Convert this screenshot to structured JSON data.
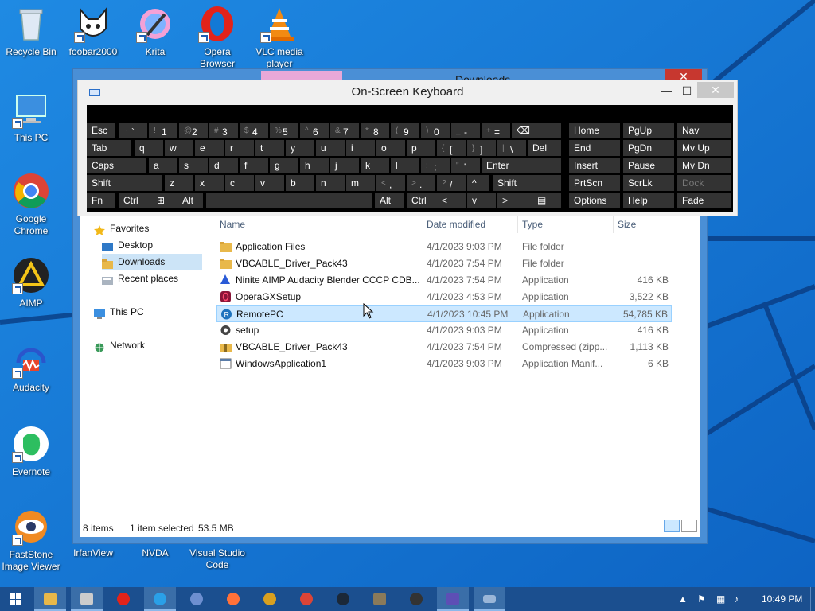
{
  "desktop": {
    "icons": [
      {
        "label": "Recycle Bin"
      },
      {
        "label": "foobar2000"
      },
      {
        "label": "Krita"
      },
      {
        "label": "Opera Browser"
      },
      {
        "label": "VLC media player"
      },
      {
        "label": "This PC"
      },
      {
        "label": "Google Chrome"
      },
      {
        "label": "AIMP"
      },
      {
        "label": "Audacity"
      },
      {
        "label": "Evernote"
      },
      {
        "label": "FastStone Image Viewer"
      },
      {
        "label": "IrfanView"
      },
      {
        "label": "NVDA"
      },
      {
        "label": "Visual Studio Code"
      }
    ]
  },
  "explorer": {
    "title": "Downloads",
    "close_glyph": "✕",
    "nav": {
      "favorites": "Favorites",
      "desktop": "Desktop",
      "downloads": "Downloads",
      "recent": "Recent places",
      "this_pc": "This PC",
      "network": "Network"
    },
    "columns": {
      "name": "Name",
      "date": "Date modified",
      "type": "Type",
      "size": "Size"
    },
    "files": [
      {
        "name": "Application Files",
        "date": "4/1/2023 9:03 PM",
        "type": "File folder",
        "size": ""
      },
      {
        "name": "VBCABLE_Driver_Pack43",
        "date": "4/1/2023 7:54 PM",
        "type": "File folder",
        "size": ""
      },
      {
        "name": "Ninite AIMP Audacity Blender CCCP CDB...",
        "date": "4/1/2023 7:54 PM",
        "type": "Application",
        "size": "416 KB"
      },
      {
        "name": "OperaGXSetup",
        "date": "4/1/2023 4:53 PM",
        "type": "Application",
        "size": "3,522 KB"
      },
      {
        "name": "RemotePC",
        "date": "4/1/2023 10:45 PM",
        "type": "Application",
        "size": "54,785 KB"
      },
      {
        "name": "setup",
        "date": "4/1/2023 9:03 PM",
        "type": "Application",
        "size": "416 KB"
      },
      {
        "name": "VBCABLE_Driver_Pack43",
        "date": "4/1/2023 7:54 PM",
        "type": "Compressed (zipp...",
        "size": "1,113 KB"
      },
      {
        "name": "WindowsApplication1",
        "date": "4/1/2023 9:03 PM",
        "type": "Application Manif...",
        "size": "6 KB"
      }
    ],
    "status": {
      "count": "8 items",
      "selected": "1 item selected",
      "size": "53.5 MB"
    }
  },
  "osk": {
    "title": "On-Screen Keyboard",
    "minimize": "—",
    "maximize": "☐",
    "close": "✕",
    "rows": {
      "r1": [
        {
          "main": "Esc"
        },
        {
          "shift": "~",
          "main": "`"
        },
        {
          "shift": "!",
          "main": "1"
        },
        {
          "shift": "@",
          "main": "2"
        },
        {
          "shift": "#",
          "main": "3"
        },
        {
          "shift": "$",
          "main": "4"
        },
        {
          "shift": "%",
          "main": "5"
        },
        {
          "shift": "^",
          "main": "6"
        },
        {
          "shift": "&",
          "main": "7"
        },
        {
          "shift": "*",
          "main": "8"
        },
        {
          "shift": "(",
          "main": "9"
        },
        {
          "shift": ")",
          "main": "0"
        },
        {
          "shift": "_",
          "main": "-"
        },
        {
          "shift": "+",
          "main": "="
        },
        {
          "main": "⌫"
        },
        {
          "main": "Home"
        },
        {
          "main": "PgUp"
        },
        {
          "main": "Nav"
        }
      ],
      "r2": [
        {
          "main": "Tab"
        },
        {
          "main": "q"
        },
        {
          "main": "w"
        },
        {
          "main": "e"
        },
        {
          "main": "r"
        },
        {
          "main": "t"
        },
        {
          "main": "y"
        },
        {
          "main": "u"
        },
        {
          "main": "i"
        },
        {
          "main": "o"
        },
        {
          "main": "p"
        },
        {
          "shift": "{",
          "main": "["
        },
        {
          "shift": "}",
          "main": "]"
        },
        {
          "shift": "|",
          "main": "\\"
        },
        {
          "main": "Del"
        },
        {
          "main": "End"
        },
        {
          "main": "PgDn"
        },
        {
          "main": "Mv Up"
        }
      ],
      "r3": [
        {
          "main": "Caps"
        },
        {
          "main": "a"
        },
        {
          "main": "s"
        },
        {
          "main": "d"
        },
        {
          "main": "f"
        },
        {
          "main": "g"
        },
        {
          "main": "h"
        },
        {
          "main": "j"
        },
        {
          "main": "k"
        },
        {
          "main": "l"
        },
        {
          "shift": ":",
          "main": ";"
        },
        {
          "shift": "\"",
          "main": "'"
        },
        {
          "main": "Enter"
        },
        {
          "main": "Insert"
        },
        {
          "main": "Pause"
        },
        {
          "main": "Mv Dn"
        }
      ],
      "r4": [
        {
          "main": "Shift"
        },
        {
          "main": "z"
        },
        {
          "main": "x"
        },
        {
          "main": "c"
        },
        {
          "main": "v"
        },
        {
          "main": "b"
        },
        {
          "main": "n"
        },
        {
          "main": "m"
        },
        {
          "shift": "<",
          "main": ","
        },
        {
          "shift": ">",
          "main": "."
        },
        {
          "shift": "?",
          "main": "/"
        },
        {
          "main": "^"
        },
        {
          "main": "Shift"
        },
        {
          "main": "PrtScn"
        },
        {
          "main": "ScrLk"
        },
        {
          "main": "Dock"
        }
      ],
      "r5": [
        {
          "main": "Fn"
        },
        {
          "main": "Ctrl"
        },
        {
          "main": "⊞"
        },
        {
          "main": "Alt"
        },
        {
          "main": ""
        },
        {
          "main": "Alt"
        },
        {
          "main": "Ctrl"
        },
        {
          "main": "<"
        },
        {
          "main": "v"
        },
        {
          "main": ">"
        },
        {
          "main": "▤"
        },
        {
          "main": "Options"
        },
        {
          "main": "Help"
        },
        {
          "main": "Fade"
        }
      ]
    }
  },
  "taskbar": {
    "clock": "10:49 PM"
  },
  "colors": {
    "desktop_bg": "#1279d6",
    "selection": "#cce8ff",
    "key_bg": "#333333",
    "taskbar": "#1b4f8f"
  }
}
